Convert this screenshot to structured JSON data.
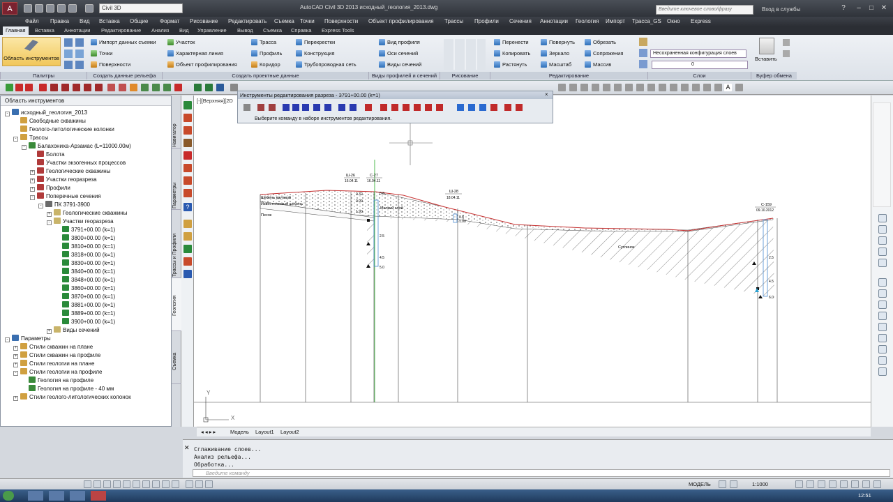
{
  "window": {
    "title": "AutoCAD Civil 3D 2013    исходный_геология_2013.dwg",
    "workspace": "Civil 3D",
    "search_placeholder": "Введите ключевое слово/фразу",
    "login": "Вход в службы"
  },
  "menu": [
    "Файл",
    "Правка",
    "Вид",
    "Вставка",
    "Общие",
    "Формат",
    "Рисование",
    "Редактировать",
    "Съемка",
    "Точки",
    "Поверхности",
    "Объект профилирования",
    "Трассы",
    "Профили",
    "Сечения",
    "Аннотации",
    "Геология",
    "Импорт",
    "Трасса_GS",
    "Окно",
    "Express"
  ],
  "tabs": [
    "Главная",
    "Вставка",
    "Аннотации",
    "Редактирование",
    "Анализ",
    "Вид",
    "Управление",
    "Вывод",
    "Съемка",
    "Справка",
    "Express Tools"
  ],
  "ribbon": {
    "big_tool": "Область инструментов",
    "palettes_title": "Палитры",
    "ground_items": [
      "Импорт данных съемки",
      "Точки",
      "Поверхности"
    ],
    "ground_title": "Создать данные рельефа",
    "design_items": [
      "Участок",
      "Характерная линия",
      "Объект профилирования",
      "Трасса",
      "Профиль",
      "Коридор",
      "Перекрестки",
      "Конструкция",
      "Трубопроводная сеть"
    ],
    "design_title": "Создать проектные данные",
    "views_items": [
      "Вид профиля",
      "Оси сечений",
      "Виды сечений"
    ],
    "views_title": "Виды профилей и сечений",
    "draw_title": "Рисование",
    "modify_items": [
      "Перенести",
      "Копировать",
      "Растянуть",
      "Повернуть",
      "Зеркало",
      "Масштаб",
      "Обрезать",
      "Сопряжения",
      "Массив"
    ],
    "modify_title": "Редактирование",
    "layer_combo": "Несохраненная конфигурация слоев",
    "layer_value": "0",
    "layers_title": "Слои",
    "paste": "Вставить",
    "clipboard_title": "Буфер обмена"
  },
  "toolspace": {
    "header": "Область инструментов",
    "tree": [
      {
        "label": "исходный_геология_2013",
        "level": 0,
        "exp": "-"
      },
      {
        "label": "Свободные скважины",
        "level": 1,
        "exp": ""
      },
      {
        "label": "Геолого-литологические колонки",
        "level": 1,
        "exp": ""
      },
      {
        "label": "Трассы",
        "level": 1,
        "exp": "-"
      },
      {
        "label": "Балахониха-Арзамас (L=11000.00м)",
        "level": 2,
        "exp": "-"
      },
      {
        "label": "Болота",
        "level": 3,
        "exp": ""
      },
      {
        "label": "Участки экзогенных процессов",
        "level": 3,
        "exp": ""
      },
      {
        "label": "Геологические скважины",
        "level": 3,
        "exp": "+"
      },
      {
        "label": "Участки георазреза",
        "level": 3,
        "exp": "+"
      },
      {
        "label": "Профили",
        "level": 3,
        "exp": "+"
      },
      {
        "label": "Поперечные сечения",
        "level": 3,
        "exp": "-"
      },
      {
        "label": "ПК 3791-3900",
        "level": 4,
        "exp": "-"
      },
      {
        "label": "Геологические скважины",
        "level": 5,
        "exp": "+"
      },
      {
        "label": "Участки георазреза",
        "level": 5,
        "exp": "-"
      },
      {
        "label": "3791+00.00 (k=1)",
        "level": 6,
        "exp": ""
      },
      {
        "label": "3800+00.00 (k=1)",
        "level": 6,
        "exp": ""
      },
      {
        "label": "3810+00.00 (k=1)",
        "level": 6,
        "exp": ""
      },
      {
        "label": "3818+00.00 (k=1)",
        "level": 6,
        "exp": ""
      },
      {
        "label": "3830+00.00 (k=1)",
        "level": 6,
        "exp": ""
      },
      {
        "label": "3840+00.00 (k=1)",
        "level": 6,
        "exp": ""
      },
      {
        "label": "3848+00.00 (k=1)",
        "level": 6,
        "exp": ""
      },
      {
        "label": "3860+00.00 (k=1)",
        "level": 6,
        "exp": ""
      },
      {
        "label": "3870+00.00 (k=1)",
        "level": 6,
        "exp": ""
      },
      {
        "label": "3881+00.00 (k=1)",
        "level": 6,
        "exp": ""
      },
      {
        "label": "3889+00.00 (k=1)",
        "level": 6,
        "exp": ""
      },
      {
        "label": "3900+00.00 (k=1)",
        "level": 6,
        "exp": ""
      },
      {
        "label": "Виды сечений",
        "level": 5,
        "exp": "+"
      },
      {
        "label": "Параметры",
        "level": 0,
        "exp": "-"
      },
      {
        "label": "Стили скважин на плане",
        "level": 1,
        "exp": "+"
      },
      {
        "label": "Стили скважин на профиле",
        "level": 1,
        "exp": "+"
      },
      {
        "label": "Стили геологии на плане",
        "level": 1,
        "exp": "+"
      },
      {
        "label": "Стили геологии на профиле",
        "level": 1,
        "exp": "-"
      },
      {
        "label": "Геология на профиле",
        "level": 2,
        "exp": ""
      },
      {
        "label": "Геология на профиле - 40 мм",
        "level": 2,
        "exp": ""
      },
      {
        "label": "Стили геолого-литологических колонок",
        "level": 1,
        "exp": "+"
      }
    ],
    "vtabs": [
      "Навигатор",
      "Параметры",
      "Трассы и Профили",
      "Геология",
      "Съемка"
    ]
  },
  "viewport_label": "[-][Верхняя][2D",
  "edit_toolbar": {
    "title": "Инструменты редактирования разреза - 3791+00.00 (k=1)",
    "hint": "Выберите команду в наборе инструментов редактирования."
  },
  "drawing": {
    "wells": [
      {
        "name": "Ш-26",
        "date": "16.04.11"
      },
      {
        "name": "С-27",
        "date": "16.04.11"
      },
      {
        "name": "Ш-28",
        "date": "18.04.11"
      },
      {
        "name": "С-159",
        "date": "09.10.2012"
      }
    ],
    "layers_text": [
      "Щебень крупный",
      "Известняковый щебень",
      "Песок",
      "Суглинок",
      "Мелкий слой"
    ],
    "depths": [
      "0.32",
      "0.99",
      "1.90",
      "0.8",
      "2.5",
      "4.5",
      "5.0",
      "0.8",
      "1.00",
      "2.5",
      "4.5",
      "6.0"
    ],
    "ucs_y": "Y",
    "ucs_x": "X"
  },
  "layout_tabs": [
    "Модель",
    "Layout1",
    "Layout2"
  ],
  "command": {
    "lines": [
      "Сглаживание слоев...",
      "Анализ рельефа...",
      "Обработка..."
    ],
    "placeholder": "Введите команду"
  },
  "status": {
    "model": "МОДЕЛЬ",
    "scale": "1:1000",
    "clock": "12:51"
  }
}
